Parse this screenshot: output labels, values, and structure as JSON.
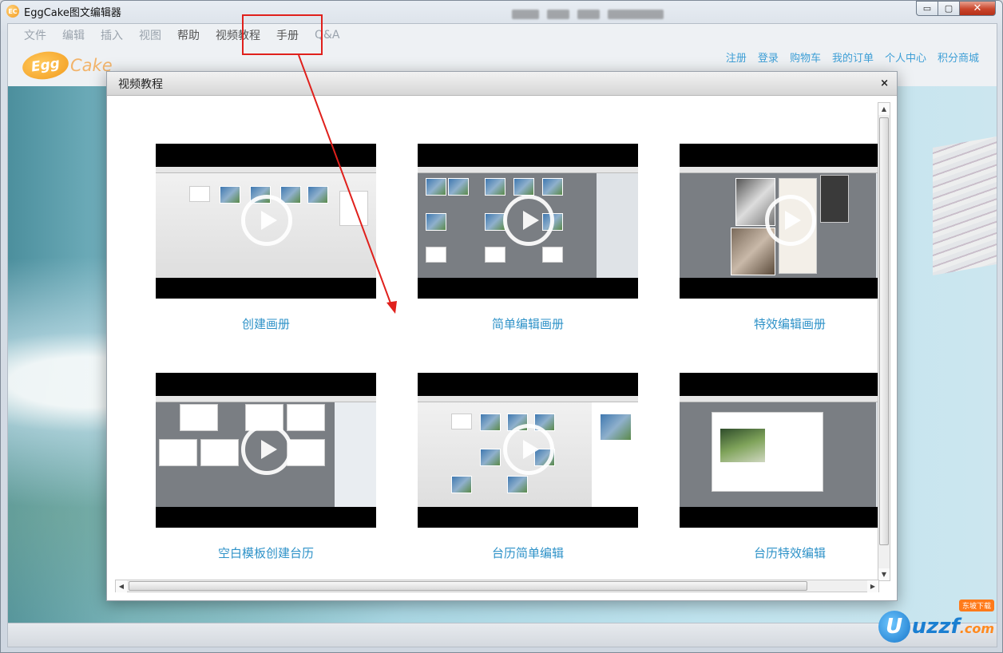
{
  "window": {
    "title": "EggCake图文编辑器",
    "icon_text": "EC",
    "controls": {
      "minimize": "▭",
      "maximize": "▢",
      "close": "✕"
    }
  },
  "menu": {
    "items": [
      "文件",
      "编辑",
      "插入",
      "视图",
      "帮助",
      "视频教程",
      "手册",
      "Q&A"
    ],
    "active_index": 5
  },
  "logo": {
    "egg": "Egg",
    "cake": "Cake"
  },
  "topnav": [
    "注册",
    "登录",
    "购物车",
    "我的订单",
    "个人中心",
    "积分商城"
  ],
  "dialog": {
    "title": "视频教程",
    "close": "×",
    "videos": [
      {
        "label": "创建画册"
      },
      {
        "label": "简单编辑画册"
      },
      {
        "label": "特效编辑画册"
      },
      {
        "label": "空白模板创建台历"
      },
      {
        "label": "台历简单编辑"
      },
      {
        "label": "台历特效编辑"
      }
    ]
  },
  "scrollbars": {
    "up": "▲",
    "down": "▼",
    "left": "◀",
    "right": "▶"
  },
  "watermark": {
    "u": "U",
    "text": "uzzf",
    "suffix": ".com",
    "badge": "东坡下载"
  },
  "colors": {
    "accent_link": "#2e92c8",
    "highlight": "#e0201c"
  }
}
